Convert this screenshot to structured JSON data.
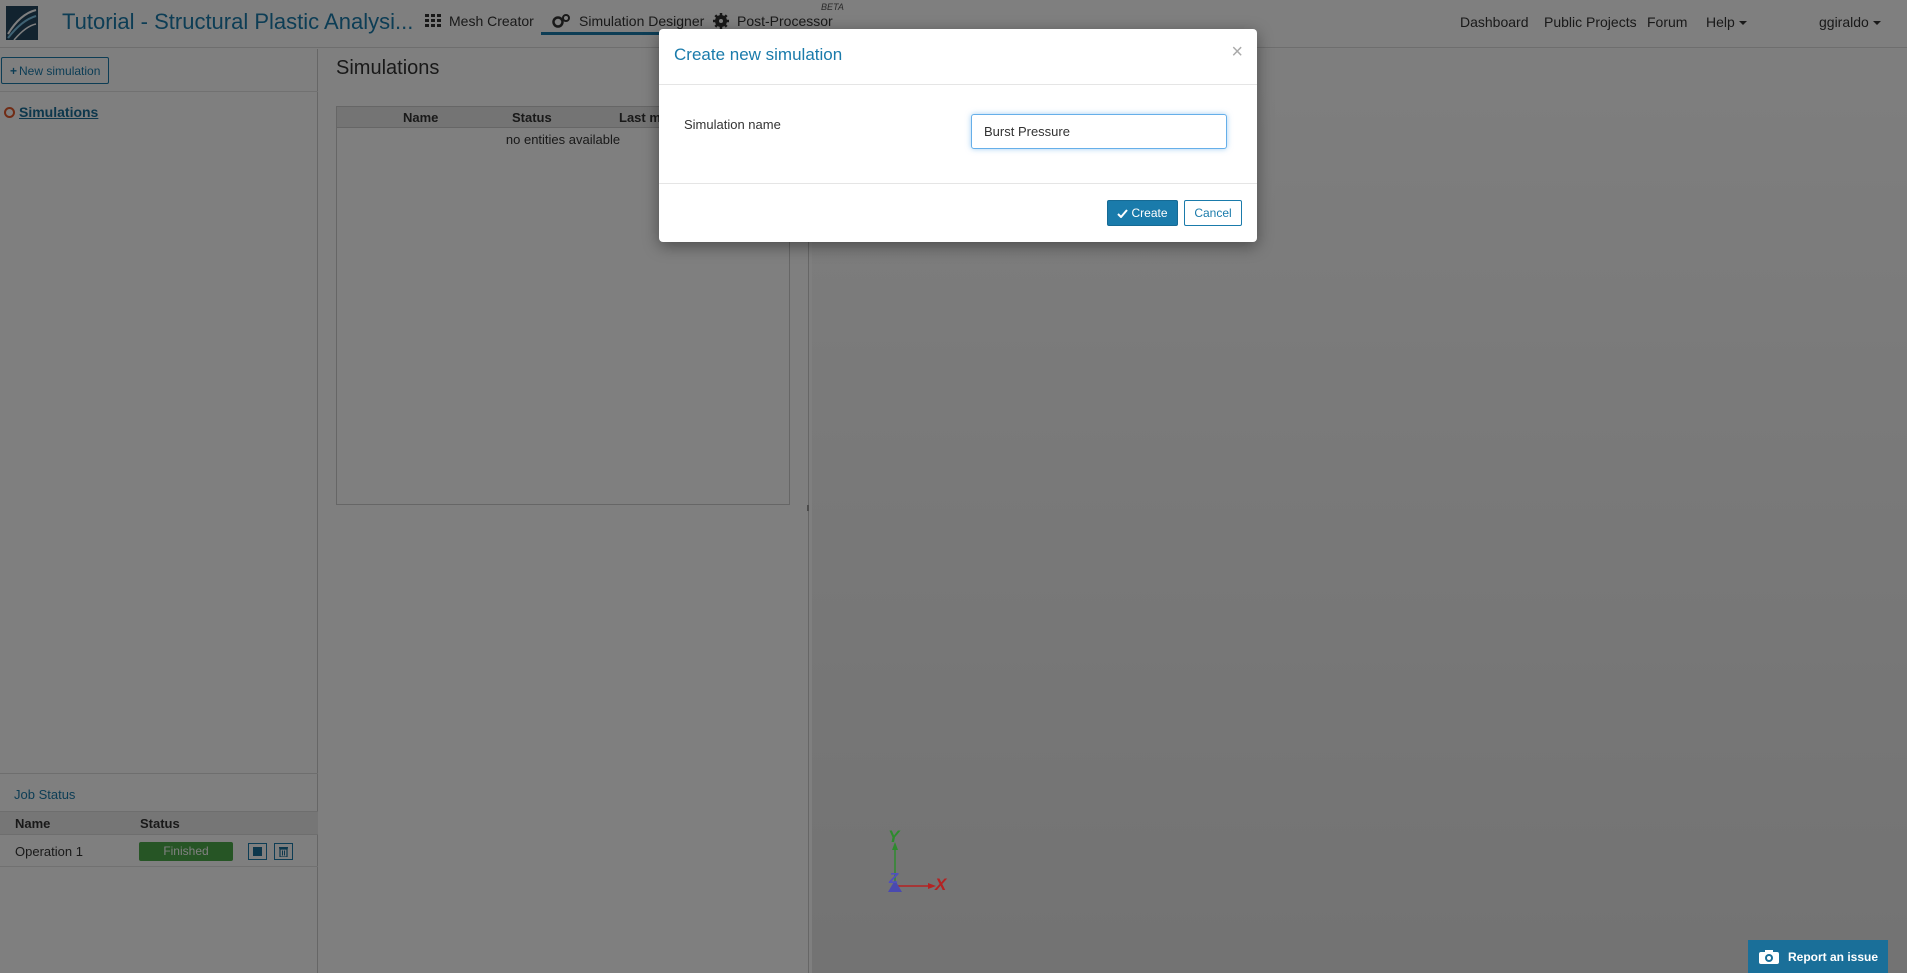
{
  "navbar": {
    "project_title": "Tutorial - Structural Plastic Analysi...",
    "tabs": [
      {
        "label": "Mesh Creator",
        "icon": "grid-icon"
      },
      {
        "label": "Simulation Designer",
        "icon": "gears-icon",
        "active": true
      },
      {
        "label": "Post-Processor",
        "icon": "cog-icon",
        "badge": "BETA"
      }
    ],
    "links": [
      "Dashboard",
      "Public Projects",
      "Forum",
      "Help"
    ],
    "user": "ggiraldo"
  },
  "sidebar": {
    "new_button_label": "New simulation",
    "tree_item": "Simulations"
  },
  "job_status": {
    "title": "Job Status",
    "columns": [
      "Name",
      "Status"
    ],
    "rows": [
      {
        "name": "Operation 1",
        "status": "Finished"
      }
    ]
  },
  "simulations_panel": {
    "title": "Simulations",
    "columns": [
      "Name",
      "Status",
      "Last m"
    ],
    "empty_text": "no entities available"
  },
  "viewport": {
    "axes": {
      "x": "X",
      "y": "Y",
      "z": "Z"
    }
  },
  "modal": {
    "title": "Create new simulation",
    "close_symbol": "×",
    "field_label": "Simulation name",
    "field_value": "Burst Pressure",
    "create_label": "Create",
    "cancel_label": "Cancel"
  },
  "report_issue_label": "Report an issue",
  "colors": {
    "accent": "#1a7bab",
    "success": "#4caa4a",
    "tree_ring": "#e2582b"
  }
}
